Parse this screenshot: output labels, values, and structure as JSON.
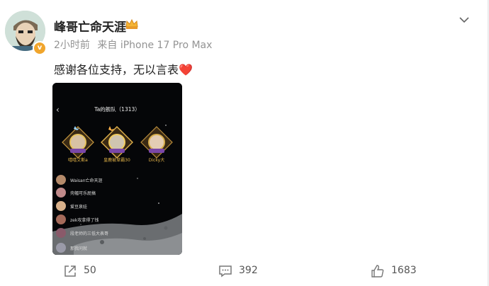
{
  "post": {
    "username": "峰哥亡命天涯",
    "time": "2小时前",
    "source": "来自 iPhone 17 Pro Max",
    "text": "感谢各位支持，无以言表",
    "heart": "❤️"
  },
  "screenshot": {
    "title": "Ta的舰队（1313）",
    "podium": [
      "嘻嘻艾斯a",
      "皇鹿被草霸30",
      "Dicky大"
    ],
    "rows": [
      "Waisan亡命天涯",
      "壳幅可乐屁搞",
      "爱豆泉娃",
      "zek攻拿得了钱",
      "段老师的三低大表哥",
      "那我问就"
    ]
  },
  "actions": {
    "share": "50",
    "comment": "392",
    "like": "1683"
  }
}
